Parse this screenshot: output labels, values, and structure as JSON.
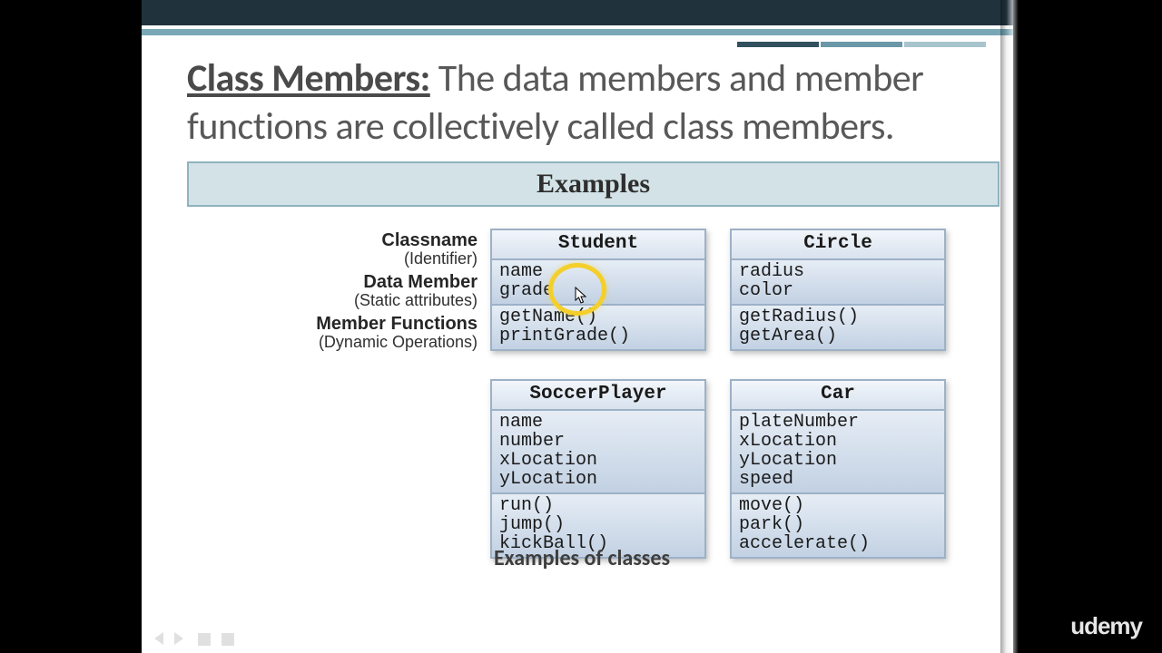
{
  "title_strong": "Class Members:",
  "title_rest": " The data members and member functions are collectively called class members.",
  "examples_label": "Examples",
  "labels": {
    "classname": "Classname",
    "classname_sub": "(Identifier)",
    "datamember": "Data Member",
    "datamember_sub": "(Static attributes)",
    "memberfns": "Member Functions",
    "memberfns_sub": "(Dynamic Operations)"
  },
  "classes": {
    "student": {
      "name": "Student",
      "data": "name\ngrade",
      "fns": "getName()\nprintGrade()"
    },
    "circle": {
      "name": "Circle",
      "data": "radius\ncolor",
      "fns": "getRadius()\ngetArea()"
    },
    "soccer": {
      "name": "SoccerPlayer",
      "data": "name\nnumber\nxLocation\nyLocation",
      "fns": "run()\njump()\nkickBall()"
    },
    "car": {
      "name": "Car",
      "data": "plateNumber\nxLocation\nyLocation\nspeed",
      "fns": "move()\npark()\naccelerate()"
    }
  },
  "caption": "Examples of classes",
  "brand": "udemy"
}
